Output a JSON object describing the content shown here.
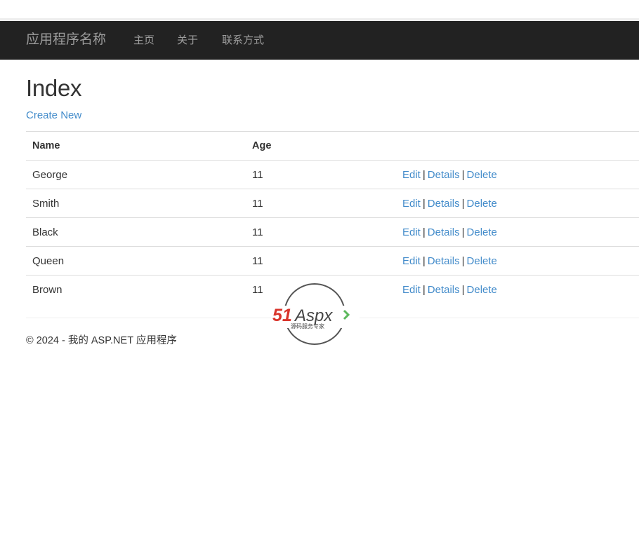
{
  "navbar": {
    "brand": "应用程序名称",
    "links": [
      "主页",
      "关于",
      "联系方式"
    ]
  },
  "page": {
    "title": "Index",
    "create_new": "Create New"
  },
  "table": {
    "headers": [
      "Name",
      "Age"
    ],
    "rows": [
      {
        "name": "George",
        "age": "11"
      },
      {
        "name": "Smith",
        "age": "11"
      },
      {
        "name": "Black",
        "age": "11"
      },
      {
        "name": "Queen",
        "age": "11"
      },
      {
        "name": "Brown",
        "age": "11"
      }
    ],
    "actions": {
      "edit": "Edit",
      "details": "Details",
      "delete": "Delete",
      "separator": "|"
    }
  },
  "footer": {
    "text": "© 2024 - 我的 ASP.NET 应用程序"
  },
  "watermark": {
    "logo_text_red": "51",
    "logo_text_dark": "Aspx",
    "tagline": "源码服务专家",
    "colors": {
      "red": "#d9342b",
      "dark": "#444444",
      "green": "#5cb85c"
    }
  },
  "colors": {
    "navbar_bg": "#222222",
    "navbar_text": "#9d9d9d",
    "link": "#428bca",
    "text": "#333333",
    "border": "#dddddd"
  }
}
